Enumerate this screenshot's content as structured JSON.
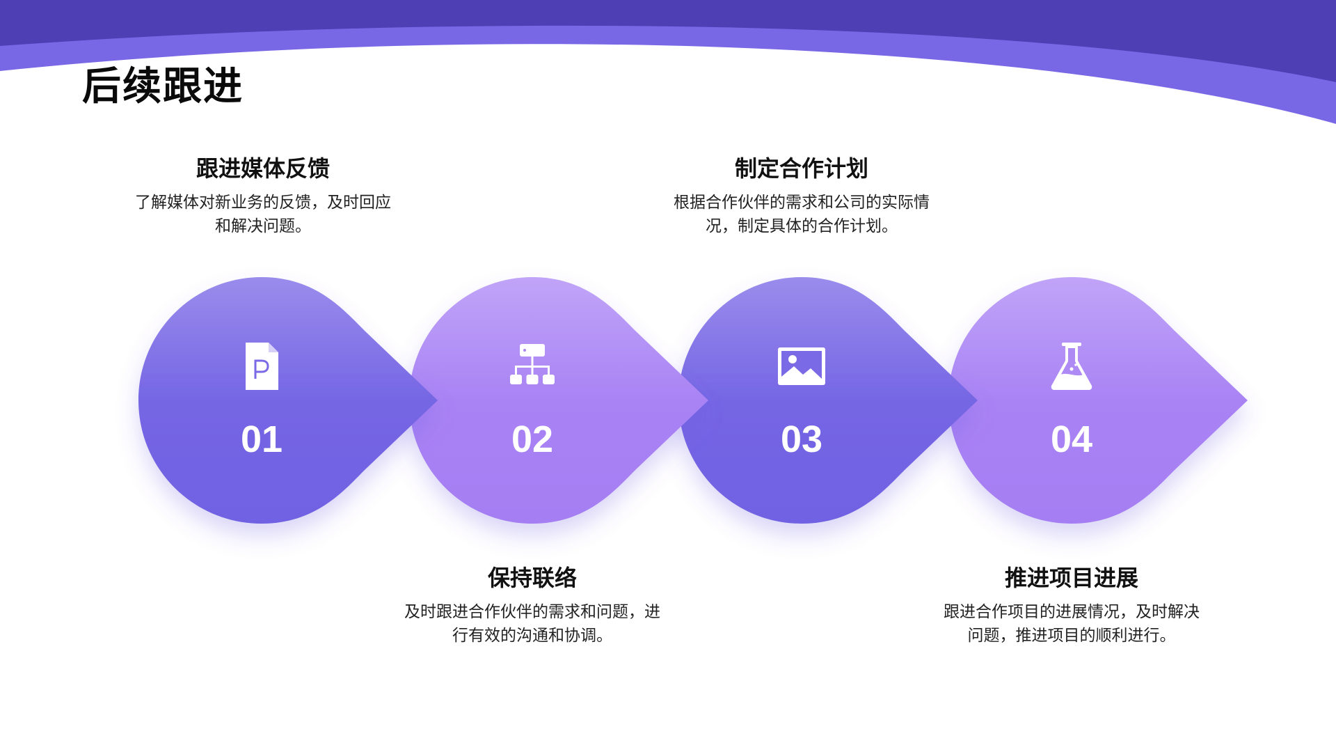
{
  "slide": {
    "title": "后续跟进"
  },
  "colors": {
    "header_dark": "#4f3fb5",
    "header_light": "#7868e6",
    "blue_top": "#9a8cec",
    "blue_bottom": "#7062e3",
    "violet_top": "#c0a4f8",
    "violet_bottom": "#a57ef3",
    "icon": "#ffffff",
    "title_text": "#0a0a0a",
    "body_text": "#222222"
  },
  "steps": [
    {
      "number": "01",
      "icon": "powerpoint-file-icon",
      "title": "跟进媒体反馈",
      "desc": "了解媒体对新业务的反馈，及时回应和解决问题。",
      "color": "blue"
    },
    {
      "number": "02",
      "icon": "sitemap-icon",
      "title": "保持联络",
      "desc": "及时跟进合作伙伴的需求和问题，进行有效的沟通和协调。",
      "color": "violet"
    },
    {
      "number": "03",
      "icon": "image-icon",
      "title": "制定合作计划",
      "desc": "根据合作伙伴的需求和公司的实际情况，制定具体的合作计划。",
      "color": "blue"
    },
    {
      "number": "04",
      "icon": "flask-icon",
      "title": "推进项目进展",
      "desc": "跟进合作项目的进展情况，及时解决问题，推进项目的顺利进行。",
      "color": "violet"
    }
  ]
}
